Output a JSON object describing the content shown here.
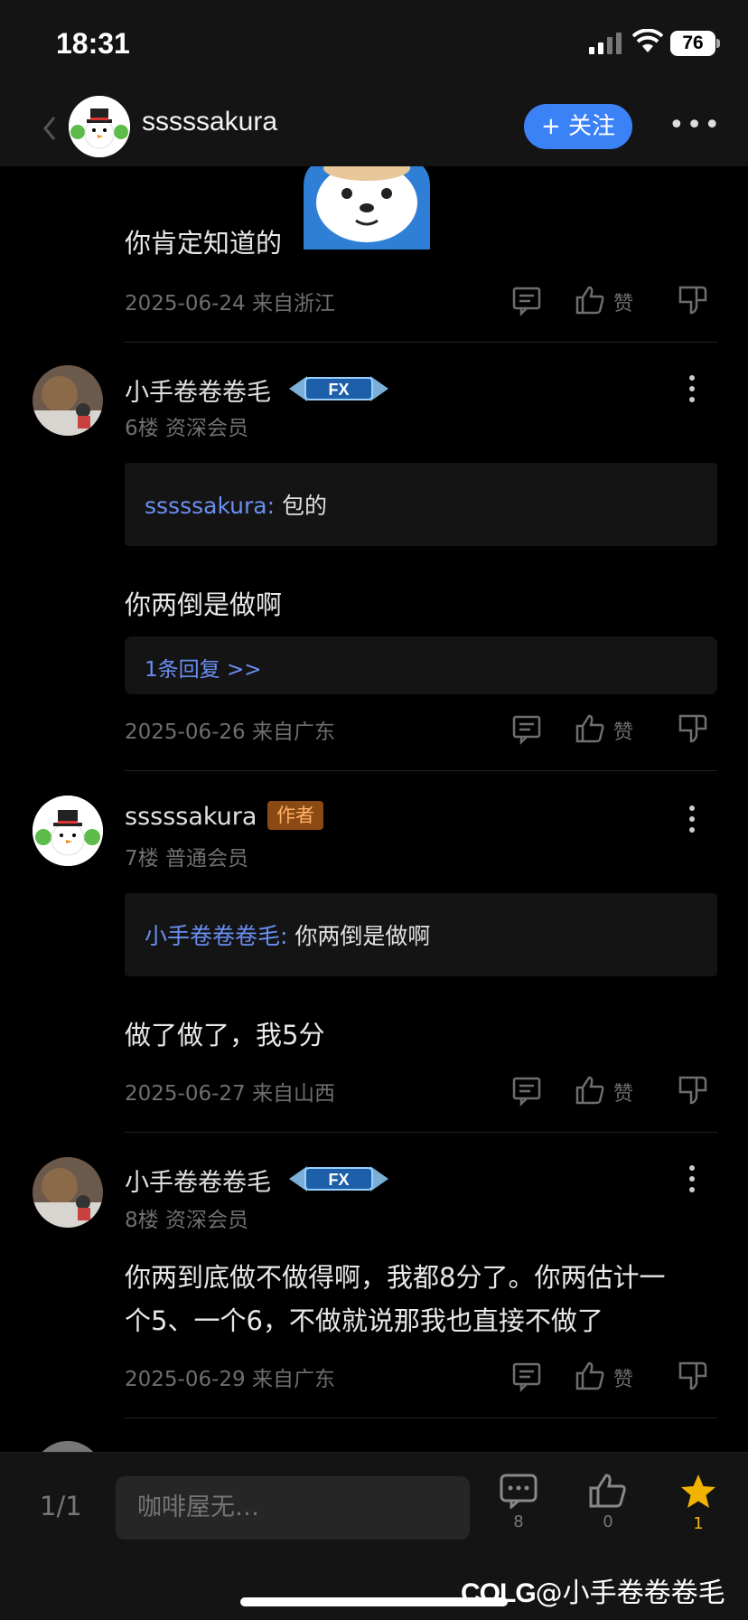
{
  "status_bar": {
    "time": "18:31",
    "battery": "76"
  },
  "nav": {
    "username": "sssssakura",
    "follow_label": "+ 关注",
    "more_label": "•••"
  },
  "posts": [
    {
      "text": "你肯定知道的",
      "meta": "2025-06-24 来自浙江",
      "like_label": "赞"
    },
    {
      "username": "小手卷卷卷毛",
      "sub": "6楼 资深会员",
      "quote_name": "sssssakura:",
      "quote_text": " 包的",
      "text": "你两倒是做啊",
      "replies_label": "1条回复 >>",
      "meta": "2025-06-26 来自广东",
      "like_label": "赞"
    },
    {
      "username": "sssssakura",
      "badge": "作者",
      "sub": "7楼 普通会员",
      "quote_name": "小手卷卷卷毛:",
      "quote_text": " 你两倒是做啊",
      "text": "做了做了，我5分",
      "meta": "2025-06-27 来自山西",
      "like_label": "赞"
    },
    {
      "username": "小手卷卷卷毛",
      "sub": "8楼 资深会员",
      "text_line1": "你两到底做不做得啊，我都8分了。你两估计一",
      "text_line2": "个5、一个6，不做就说那我也直接不做了",
      "meta": "2025-06-29 来自广东",
      "like_label": "赞"
    }
  ],
  "bottom_bar": {
    "page": "1/1",
    "input_placeholder": "咖啡屋无…",
    "comment_count": "8",
    "like_count": "0",
    "favorite_count": "1"
  },
  "watermark": {
    "logo": "COLG",
    "handle": "@小手卷卷卷毛"
  },
  "colors": {
    "accent_blue": "#3b82f6",
    "link_blue": "#6a8ff3",
    "author_badge": "#8a4a12",
    "star_gold": "#f0b400"
  }
}
